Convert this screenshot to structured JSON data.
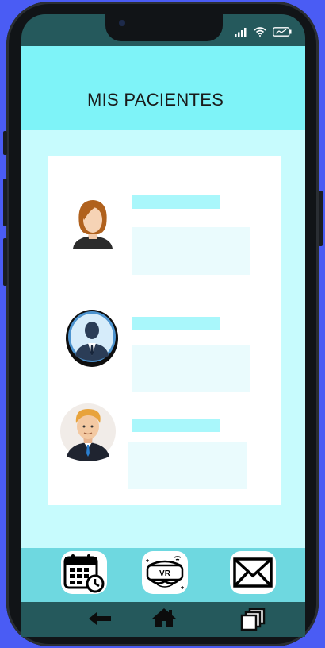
{
  "header": {
    "title": "MIS PACIENTES"
  },
  "patients": [
    {
      "avatar": "female-patient-avatar"
    },
    {
      "avatar": "male-patient-suit-avatar"
    },
    {
      "avatar": "male-patient-blond-avatar"
    }
  ],
  "bottom_nav": [
    {
      "icon": "calendar-clock-icon"
    },
    {
      "icon": "vr-headset-icon",
      "label": "VR"
    },
    {
      "icon": "mail-icon"
    }
  ],
  "system_nav": [
    "back-arrow-icon",
    "home-icon",
    "recent-apps-icon"
  ],
  "colors": {
    "header": "#7ef3f8",
    "content": "#c7fbfd",
    "nav": "#6ed8e0",
    "frame_bg": "#4a5cf4"
  }
}
